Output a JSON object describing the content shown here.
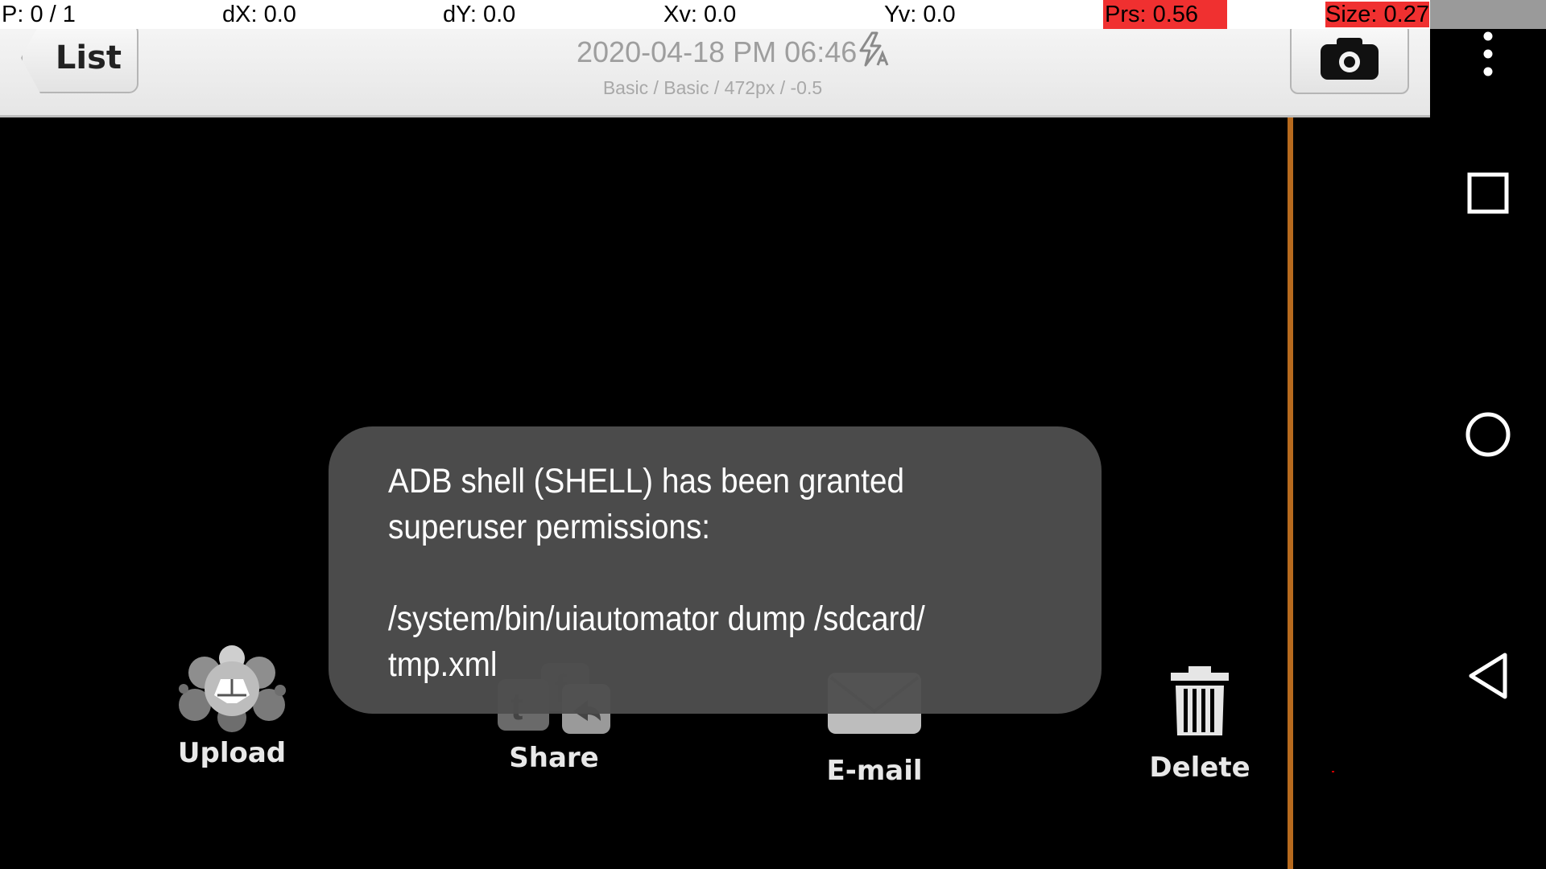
{
  "debug": {
    "pointers": "P: 0 / 1",
    "dx": "dX: 0.0",
    "dy": "dY: 0.0",
    "xv": "Xv: 0.0",
    "yv": "Yv: 0.0",
    "prs": "Prs: 0.56",
    "size": "Size: 0.27"
  },
  "header": {
    "back_label": "List",
    "title": "2020-04-18 PM 06:46",
    "subtitle": "Basic / Basic / 472px / -0.5",
    "flash_icon": "flash-auto-icon",
    "camera_icon": "camera-icon"
  },
  "actions": [
    {
      "label": "Upload",
      "icon": "upload-icon"
    },
    {
      "label": "Share",
      "icon": "share-icon"
    },
    {
      "label": "E-mail",
      "icon": "email-icon"
    },
    {
      "label": "Delete",
      "icon": "trash-icon"
    }
  ],
  "toast": {
    "message": "ADB shell (SHELL) has been granted\nsuperuser permissions:\n\n/system/bin/uiautomator dump /sdcard/\ntmp.xml"
  },
  "nav": {
    "menu_icon": "more-vert-icon",
    "recents_icon": "recents-icon",
    "home_icon": "home-icon",
    "back_icon": "back-icon"
  },
  "colors": {
    "highlight": "#f03030",
    "accent_line": "#b76a1e",
    "toast_bg": "#4e4e4e"
  }
}
